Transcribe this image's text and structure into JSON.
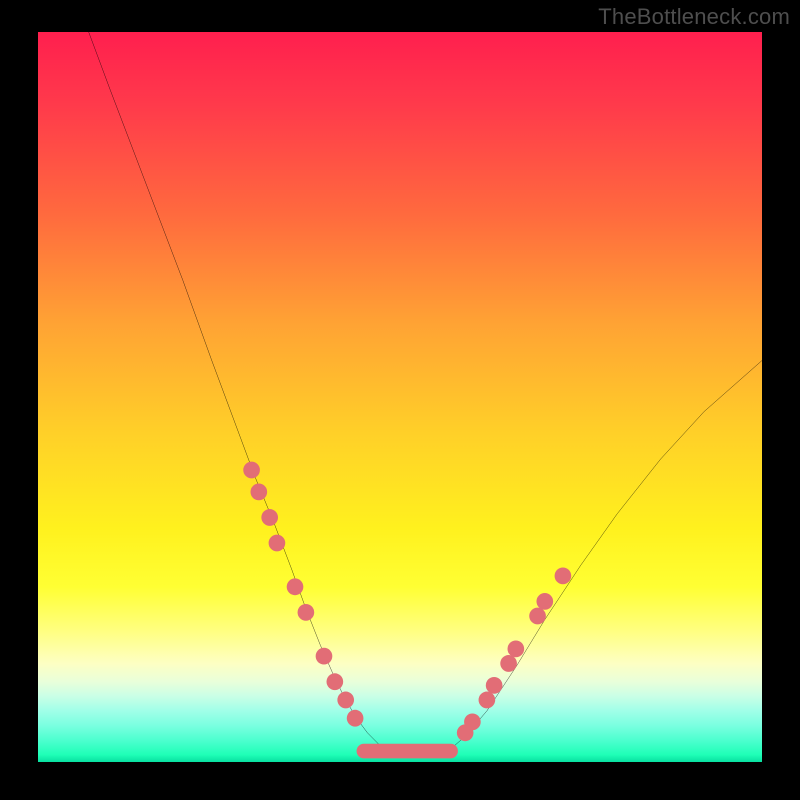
{
  "watermark": "TheBottleneck.com",
  "chart_data": {
    "type": "line",
    "title": "",
    "xlabel": "",
    "ylabel": "",
    "xlim": [
      0,
      100
    ],
    "ylim": [
      0,
      100
    ],
    "series": [
      {
        "name": "bottleneck-curve",
        "x": [
          7,
          10,
          15,
          20,
          24,
          27,
          30,
          32.5,
          35,
          37,
          39,
          41,
          42.5,
          44,
          45.5,
          47,
          49,
          51,
          53,
          55,
          57,
          59,
          62,
          66,
          70,
          75,
          80,
          86,
          92,
          100
        ],
        "y": [
          100,
          92,
          79,
          66,
          55,
          47,
          39,
          33,
          26.5,
          21,
          16,
          11.5,
          8.5,
          6,
          4,
          2.5,
          1.2,
          0.7,
          0.6,
          0.8,
          1.8,
          3.5,
          7,
          13,
          19.5,
          27,
          34,
          41.5,
          48,
          55
        ]
      }
    ],
    "highlight_points": {
      "name": "markers",
      "color": "#e26d76",
      "points": [
        {
          "x": 29.5,
          "y": 40
        },
        {
          "x": 30.5,
          "y": 37
        },
        {
          "x": 32,
          "y": 33.5
        },
        {
          "x": 33,
          "y": 30
        },
        {
          "x": 35.5,
          "y": 24
        },
        {
          "x": 37,
          "y": 20.5
        },
        {
          "x": 39.5,
          "y": 14.5
        },
        {
          "x": 41,
          "y": 11
        },
        {
          "x": 42.5,
          "y": 8.5
        },
        {
          "x": 43.8,
          "y": 6
        },
        {
          "x": 59,
          "y": 4
        },
        {
          "x": 60,
          "y": 5.5
        },
        {
          "x": 62,
          "y": 8.5
        },
        {
          "x": 63,
          "y": 10.5
        },
        {
          "x": 65,
          "y": 13.5
        },
        {
          "x": 66,
          "y": 15.5
        },
        {
          "x": 69,
          "y": 20
        },
        {
          "x": 70,
          "y": 22
        },
        {
          "x": 72.5,
          "y": 25.5
        }
      ]
    },
    "highlight_segment": {
      "name": "bottom-bar",
      "color": "#e26d76",
      "x_start": 44,
      "x_end": 58,
      "y": 1.5
    },
    "gradient_scale": {
      "description": "background color scale vs y (0-100)",
      "stops": [
        {
          "y": 100,
          "color": "#ff1f4e"
        },
        {
          "y": 75,
          "color": "#ff6a3e"
        },
        {
          "y": 55,
          "color": "#ffa334"
        },
        {
          "y": 40,
          "color": "#ffd028"
        },
        {
          "y": 25,
          "color": "#ffff33"
        },
        {
          "y": 12,
          "color": "#fdffc3"
        },
        {
          "y": 5,
          "color": "#7affe0"
        },
        {
          "y": 0,
          "color": "#08e0a0"
        }
      ]
    }
  }
}
